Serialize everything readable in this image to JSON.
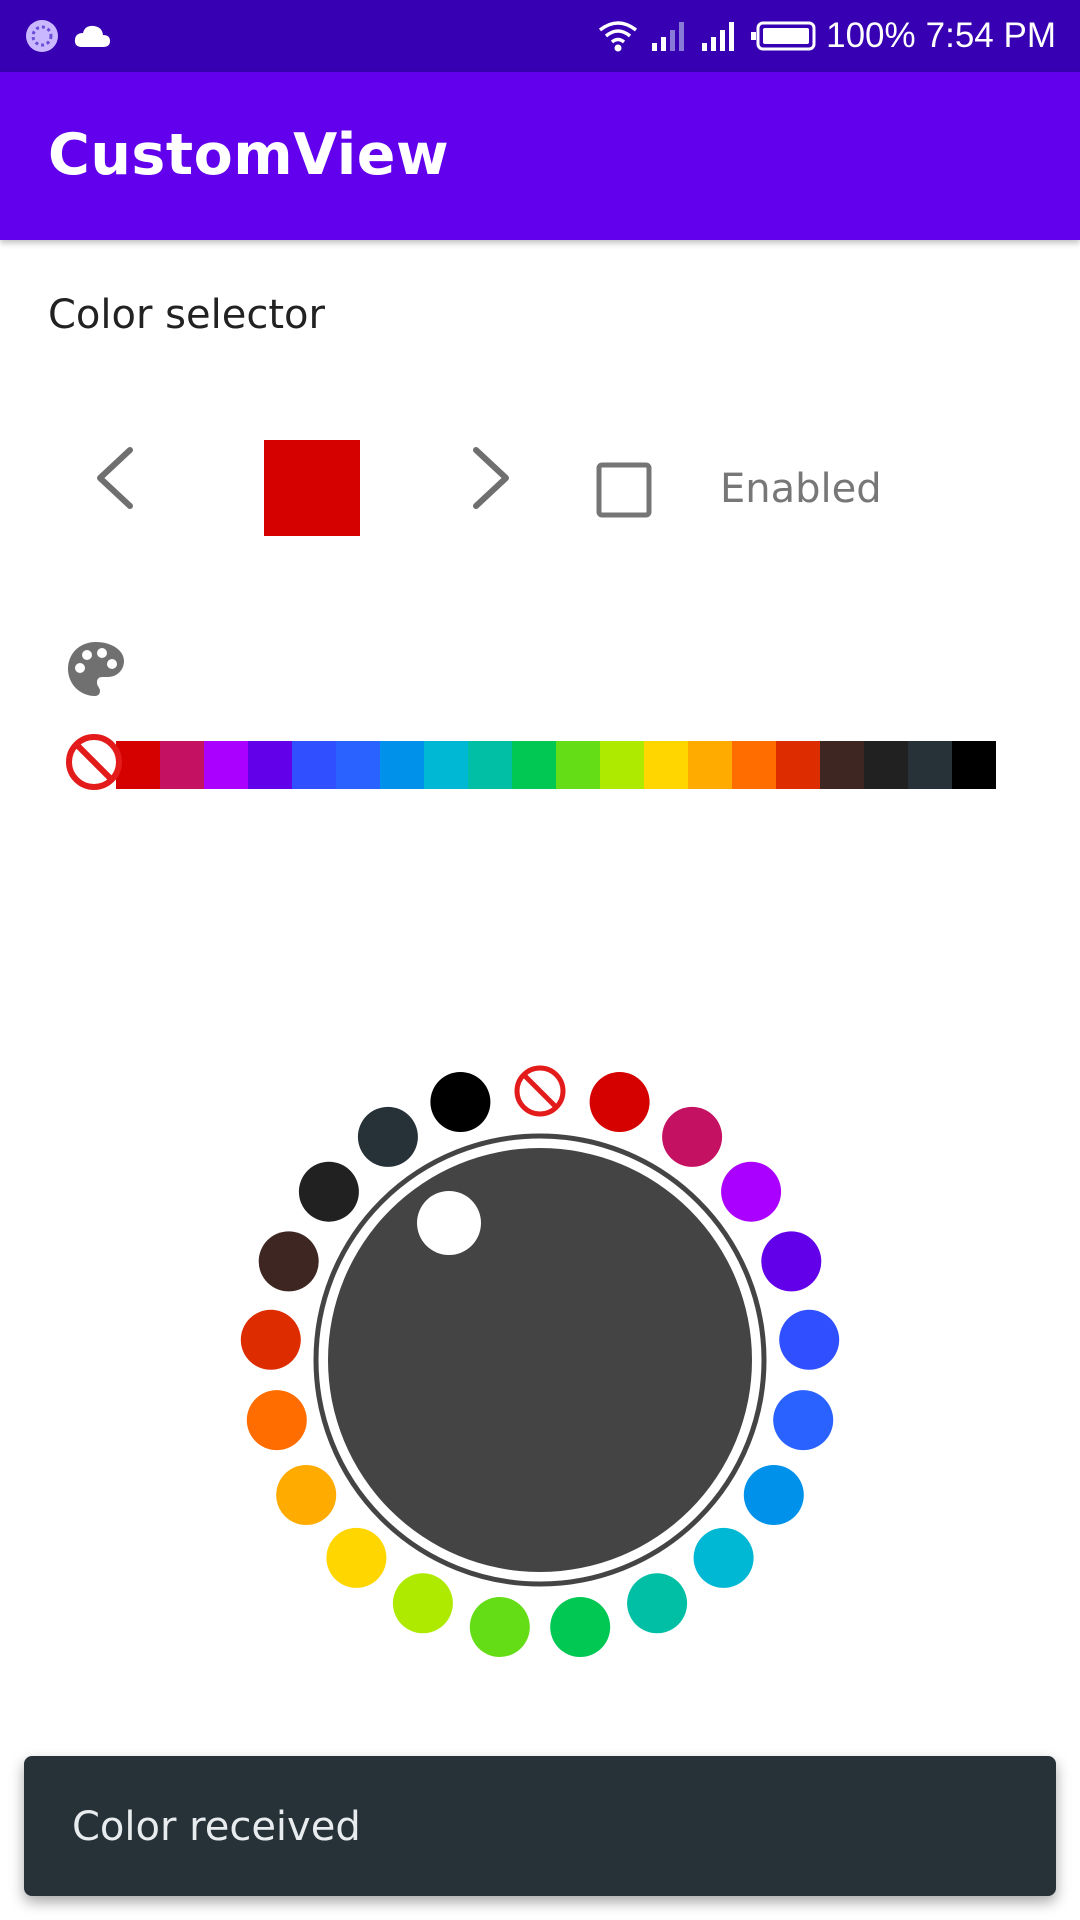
{
  "status_bar": {
    "battery_percent": "100%",
    "time": "7:54 PM",
    "icons": [
      "app-notification-icon",
      "cloud-icon",
      "wifi-icon",
      "cell-signal-icon",
      "cell-signal-icon",
      "battery-icon"
    ]
  },
  "app_bar": {
    "title": "CustomView"
  },
  "selector": {
    "label": "Color selector",
    "selected_color": "#d50000",
    "enabled_label": "Enabled",
    "enabled_checked": false
  },
  "palette": {
    "icon": "palette-icon",
    "colors": [
      "#d50000",
      "#c51162",
      "#aa00ff",
      "#6200ea",
      "#304ffe",
      "#2962ff",
      "#0091ea",
      "#00b8d4",
      "#00bfa5",
      "#00c853",
      "#64dd17",
      "#aeea00",
      "#ffd600",
      "#ffab00",
      "#ff6d00",
      "#dd2c00",
      "#3e2723",
      "#212121",
      "#263238",
      "#000000"
    ]
  },
  "snackbar": {
    "message": "Color received"
  }
}
